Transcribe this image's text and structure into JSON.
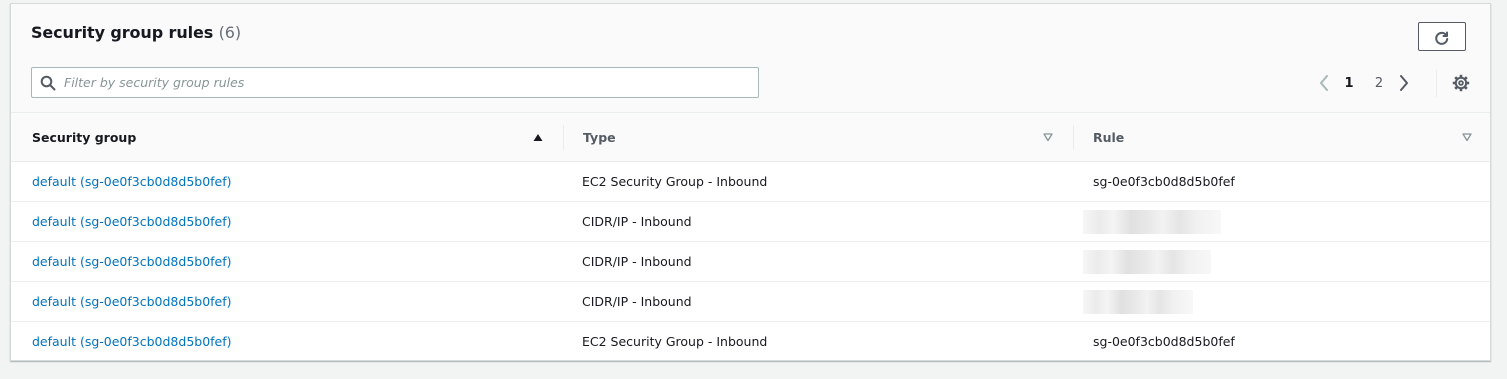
{
  "panel": {
    "title": "Security group rules",
    "count": "(6)"
  },
  "search": {
    "placeholder": "Filter by security group rules",
    "value": ""
  },
  "pagination": {
    "pages": [
      "1",
      "2"
    ],
    "current_page": "1"
  },
  "table": {
    "columns": [
      {
        "label": "Security group",
        "sort": "ascending"
      },
      {
        "label": "Type",
        "sort": "none"
      },
      {
        "label": "Rule",
        "sort": "none"
      }
    ],
    "rows": [
      {
        "security_group": "default (sg-0e0f3cb0d8d5b0fef)",
        "type": "EC2 Security Group - Inbound",
        "rule": "sg-0e0f3cb0d8d5b0fef"
      },
      {
        "security_group": "default (sg-0e0f3cb0d8d5b0fef)",
        "type": "CIDR/IP - Inbound",
        "rule": ""
      },
      {
        "security_group": "default (sg-0e0f3cb0d8d5b0fef)",
        "type": "CIDR/IP - Inbound",
        "rule": ""
      },
      {
        "security_group": "default (sg-0e0f3cb0d8d5b0fef)",
        "type": "CIDR/IP - Inbound",
        "rule": ""
      },
      {
        "security_group": "default (sg-0e0f3cb0d8d5b0fef)",
        "type": "EC2 Security Group - Inbound",
        "rule": "sg-0e0f3cb0d8d5b0fef"
      }
    ]
  },
  "icons": {
    "refresh": "refresh-icon",
    "search": "search-icon",
    "prev": "chevron-left-icon",
    "next": "chevron-right-icon",
    "settings": "gear-icon",
    "sort_asc": "sort-ascending-icon",
    "sort_none": "sort-unsorted-icon"
  },
  "colors": {
    "link": "#0073bb",
    "header_bg": "#fafafa",
    "border": "#eaeded",
    "page_bg": "#f2f3f3"
  }
}
